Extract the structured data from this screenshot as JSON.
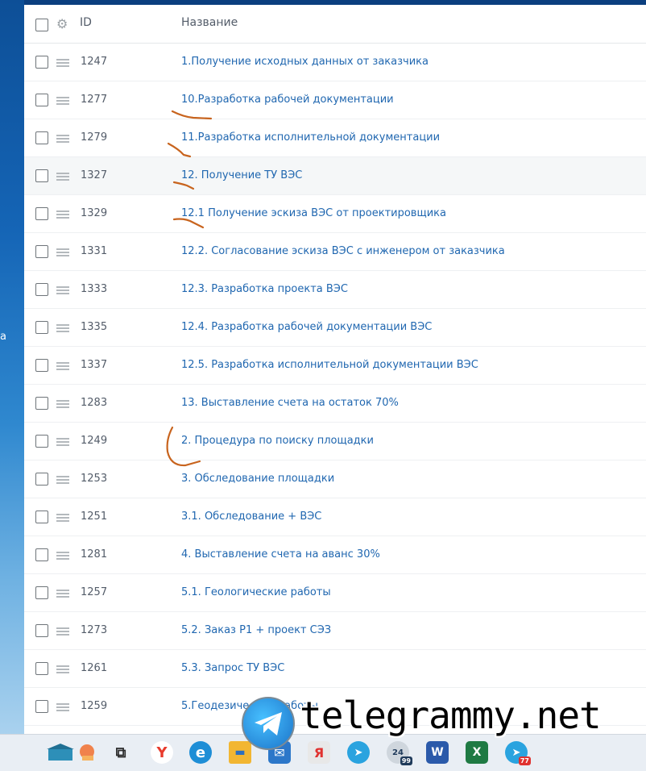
{
  "desktop": {
    "edge_text": "а"
  },
  "table": {
    "header": {
      "id_label": "ID",
      "name_label": "Название"
    },
    "rows": [
      {
        "id": "1247",
        "name": "1.Получение исходных данных от заказчика"
      },
      {
        "id": "1277",
        "name": "10.Разработка рабочей документации"
      },
      {
        "id": "1279",
        "name": "11.Разработка исполнительной документации"
      },
      {
        "id": "1327",
        "name": "12. Получение ТУ ВЭС"
      },
      {
        "id": "1329",
        "name": "12.1 Получение эскиза ВЭС от проектировщика"
      },
      {
        "id": "1331",
        "name": "12.2. Согласование эскиза ВЭС с инженером от заказчика"
      },
      {
        "id": "1333",
        "name": "12.3. Разработка проекта ВЭС"
      },
      {
        "id": "1335",
        "name": "12.4. Разработка рабочей документации ВЭС"
      },
      {
        "id": "1337",
        "name": "12.5. Разработка исполнительной документации ВЭС"
      },
      {
        "id": "1283",
        "name": "13. Выставление счета на остаток 70%"
      },
      {
        "id": "1249",
        "name": "2. Процедура по поиску площадки"
      },
      {
        "id": "1253",
        "name": "3. Обследование площадки"
      },
      {
        "id": "1251",
        "name": "3.1. Обследование + ВЭС"
      },
      {
        "id": "1281",
        "name": "4. Выставление счета на аванс 30%"
      },
      {
        "id": "1257",
        "name": "5.1. Геологические работы"
      },
      {
        "id": "1273",
        "name": "5.2. Заказ Р1 + проект СЭЗ"
      },
      {
        "id": "1261",
        "name": "5.3. Запрос ТУ ВЭС"
      },
      {
        "id": "1259",
        "name": "5.Геодезические работы"
      }
    ]
  },
  "taskbar": {
    "icons": [
      {
        "name": "task-view-icon",
        "glyph": "⧉",
        "color": "#2b2b2b"
      },
      {
        "name": "yandex-browser-icon",
        "glyph": "Y",
        "color": "#e83a2c"
      },
      {
        "name": "edge-icon",
        "glyph": "e",
        "color": "#1e8ed6"
      },
      {
        "name": "file-explorer-icon",
        "glyph": "▬",
        "color": "#f2b632"
      },
      {
        "name": "mail-icon",
        "glyph": "✉",
        "color": "#2c77c9"
      },
      {
        "name": "yandex-icon",
        "glyph": "Я",
        "color": "#e8e8e8"
      },
      {
        "name": "telegram-icon",
        "glyph": "➤",
        "color": "#2aa3df"
      },
      {
        "name": "calendar-24-icon",
        "glyph": "24",
        "color": "#cfd6dd"
      },
      {
        "name": "word-icon",
        "glyph": "W",
        "color": "#2b5aaa"
      },
      {
        "name": "excel-icon",
        "glyph": "X",
        "color": "#1f7a43"
      },
      {
        "name": "telegram-badge-icon",
        "glyph": "➤",
        "color": "#2aa3df"
      }
    ],
    "calendar_badge": "99",
    "telegram_badge": "77"
  },
  "watermark": {
    "text": "telegrammy.net"
  },
  "annotation_color": "#c8641e"
}
